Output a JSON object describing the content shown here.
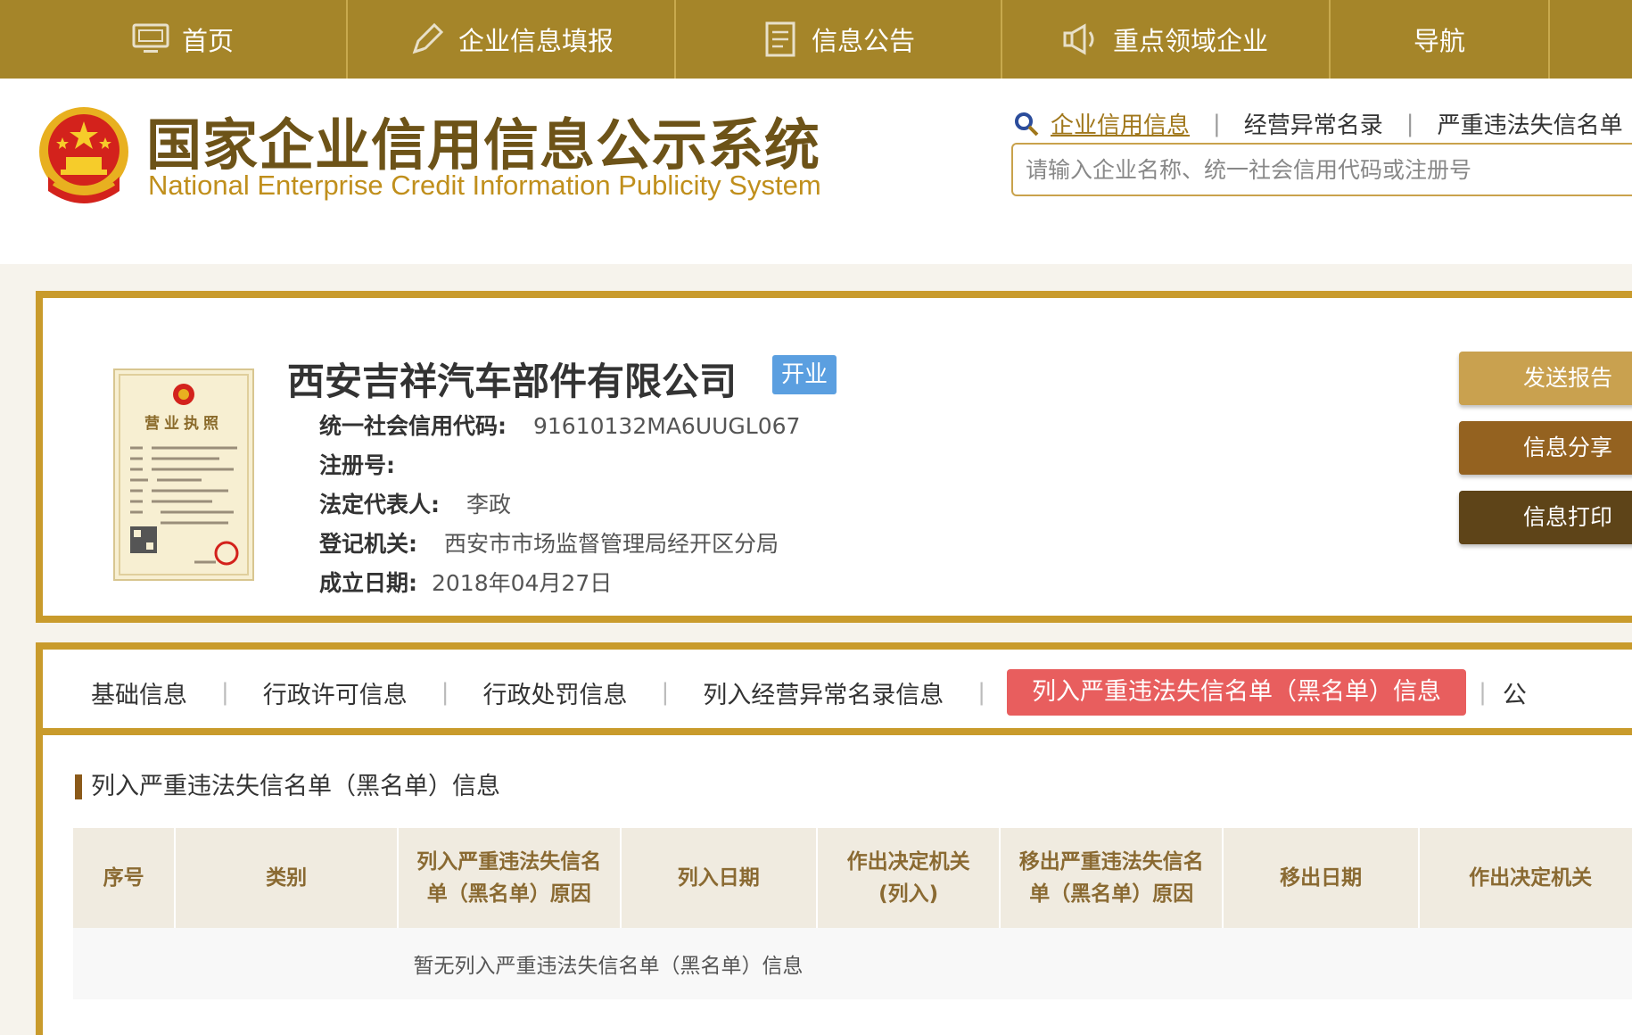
{
  "nav": {
    "items": [
      {
        "label": "首页",
        "icon": "monitor-icon"
      },
      {
        "label": "企业信息填报",
        "icon": "pen-icon"
      },
      {
        "label": "信息公告",
        "icon": "document-icon"
      },
      {
        "label": "重点领域企业",
        "icon": "speaker-icon"
      },
      {
        "label": "导航",
        "icon": ""
      }
    ]
  },
  "header": {
    "title_cn": "国家企业信用信息公示系统",
    "title_en": "National Enterprise Credit Information Publicity System",
    "search_tabs": [
      "企业信用信息",
      "经营异常名录",
      "严重违法失信名单"
    ],
    "search_placeholder": "请输入企业名称、统一社会信用代码或注册号"
  },
  "company": {
    "name": "西安吉祥汽车部件有限公司",
    "status": "开业",
    "fields": [
      {
        "label": "统一社会信用代码:",
        "value": "91610132MA6UUGL067"
      },
      {
        "label": "注册号:",
        "value": ""
      },
      {
        "label": "法定代表人:",
        "value": "李政"
      },
      {
        "label": "登记机关:",
        "value": "西安市市场监督管理局经开区分局"
      },
      {
        "label": "成立日期:",
        "value": "2018年04月27日"
      }
    ],
    "license_title": "营业执照",
    "actions": [
      "发送报告",
      "信息分享",
      "信息打印"
    ]
  },
  "tabs": {
    "items": [
      "基础信息",
      "行政许可信息",
      "行政处罚信息",
      "列入经营异常名录信息",
      "列入严重违法失信名单（黑名单）信息",
      "公"
    ],
    "active_index": 4
  },
  "section": {
    "title": "列入严重违法失信名单（黑名单）信息",
    "columns": [
      "序号",
      "类别",
      "列入严重违法失信名单（黑名单）原因",
      "列入日期",
      "作出决定机关(列入)",
      "移出严重违法失信名单（黑名单）原因",
      "移出日期",
      "作出决定机关"
    ],
    "empty_text": "暂无列入严重违法失信名单（黑名单）信息"
  },
  "colors": {
    "nav_bg": "#a58529",
    "border_gold": "#c99b2c",
    "active_tab": "#e85e5e",
    "status_badge": "#5b9fe0",
    "btn1": "#c9a14f",
    "btn2": "#946220",
    "btn3": "#5e4418"
  }
}
